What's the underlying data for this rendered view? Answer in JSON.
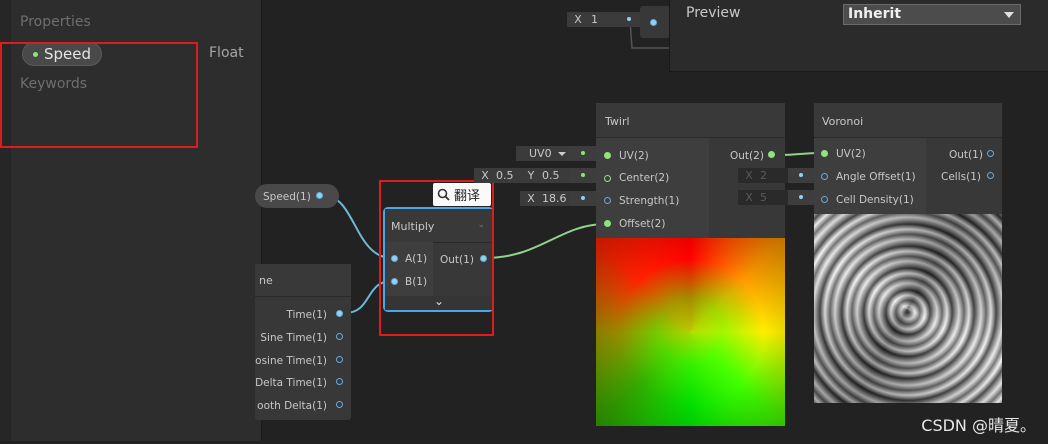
{
  "blackboard": {
    "properties_label": "Properties",
    "speed_label": "Speed",
    "speed_type": "Float",
    "keywords_label": "Keywords"
  },
  "top_fragment": {
    "x_label": "X",
    "x_value": "1"
  },
  "preview": {
    "label": "Preview",
    "dropdown_value": "Inherit"
  },
  "speed_node": {
    "label": "Speed(1)"
  },
  "time_node": {
    "title_fragment": "ne",
    "outputs": [
      "Time(1)",
      "Sine Time(1)",
      "osine Time(1)",
      "Delta Time(1)",
      "ooth Delta(1)"
    ]
  },
  "translate_popup": {
    "label": "翻译"
  },
  "multiply_node": {
    "title": "Multiply",
    "inputs": [
      "A(1)",
      "B(1)"
    ],
    "output": "Out(1)"
  },
  "twirl_node": {
    "title": "Twirl",
    "inputs": [
      "UV(2)",
      "Center(2)",
      "Strength(1)",
      "Offset(2)"
    ],
    "output": "Out(2)",
    "uv_value": "UV0",
    "center_x_label": "X",
    "center_x": "0.5",
    "center_y_label": "Y",
    "center_y": "0.5",
    "strength_x_label": "X",
    "strength": "18.6"
  },
  "voronoi_node": {
    "title": "Voronoi",
    "inputs": [
      "UV(2)",
      "Angle Offset(1)",
      "Cell Density(1)"
    ],
    "outputs": [
      "Out(1)",
      "Cells(1)"
    ],
    "angle_x_label": "X",
    "angle_value": "2",
    "density_x_label": "X",
    "density_value": "5"
  },
  "watermark": "CSDN @晴夏。",
  "colors": {
    "wire_float": "#6fb8d6",
    "wire_vec2": "#8fd38b",
    "highlight_red": "#e01b1b",
    "selection_blue": "#4aa8e8"
  }
}
